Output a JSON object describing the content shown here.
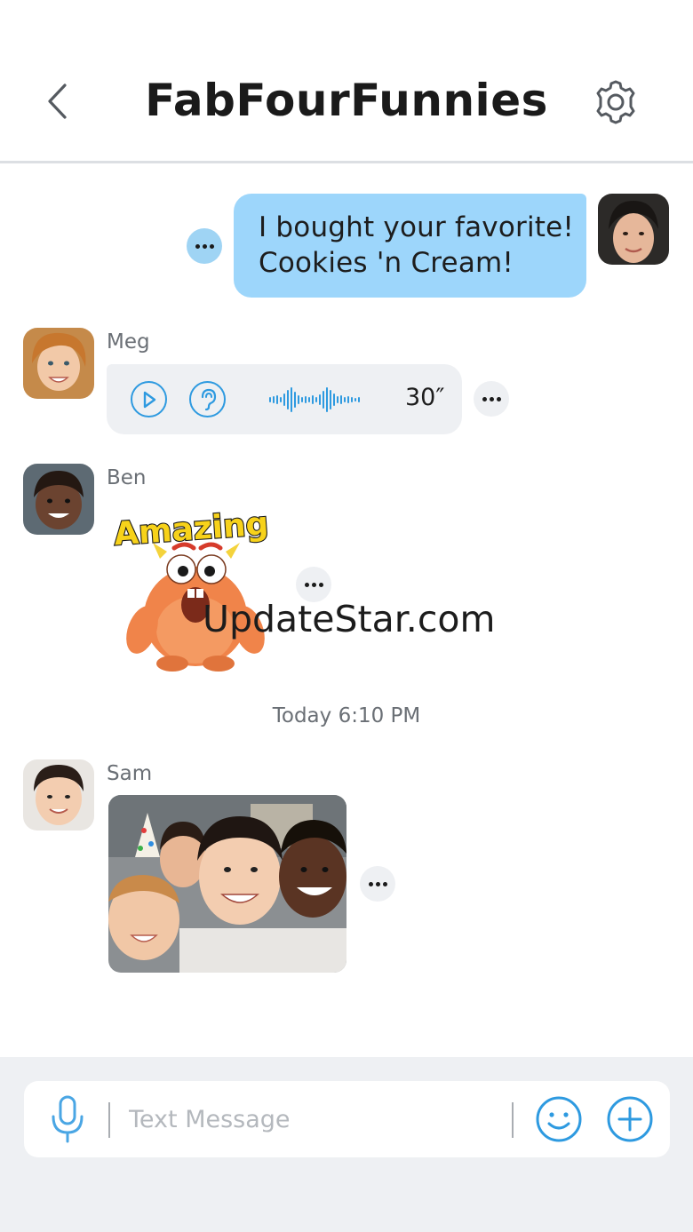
{
  "header": {
    "title": "FabFourFunnies",
    "back_icon": "chevron-left-icon",
    "settings_icon": "gear-icon"
  },
  "messages": [
    {
      "type": "text",
      "outgoing": true,
      "lines": [
        "I bought your favorite!",
        "Cookies 'n Cream!"
      ]
    },
    {
      "type": "voice",
      "sender": "Meg",
      "duration": "30″",
      "icons": [
        "play-icon",
        "ear-icon",
        "waveform-icon"
      ]
    },
    {
      "type": "sticker",
      "sender": "Ben",
      "sticker_text": "Amazing"
    },
    {
      "type": "photo",
      "sender": "Sam"
    }
  ],
  "timestamp": "Today 6:10 PM",
  "watermark": "UpdateStar.com",
  "composer": {
    "placeholder": "Text Message",
    "value": "",
    "icons": [
      "microphone-icon",
      "emoji-icon",
      "plus-icon"
    ]
  },
  "colors": {
    "accent": "#2e9ae0",
    "outgoing_bubble": "#9dd6fb",
    "incoming_bubble": "#eef0f3",
    "footer_bg": "#eef0f3"
  }
}
